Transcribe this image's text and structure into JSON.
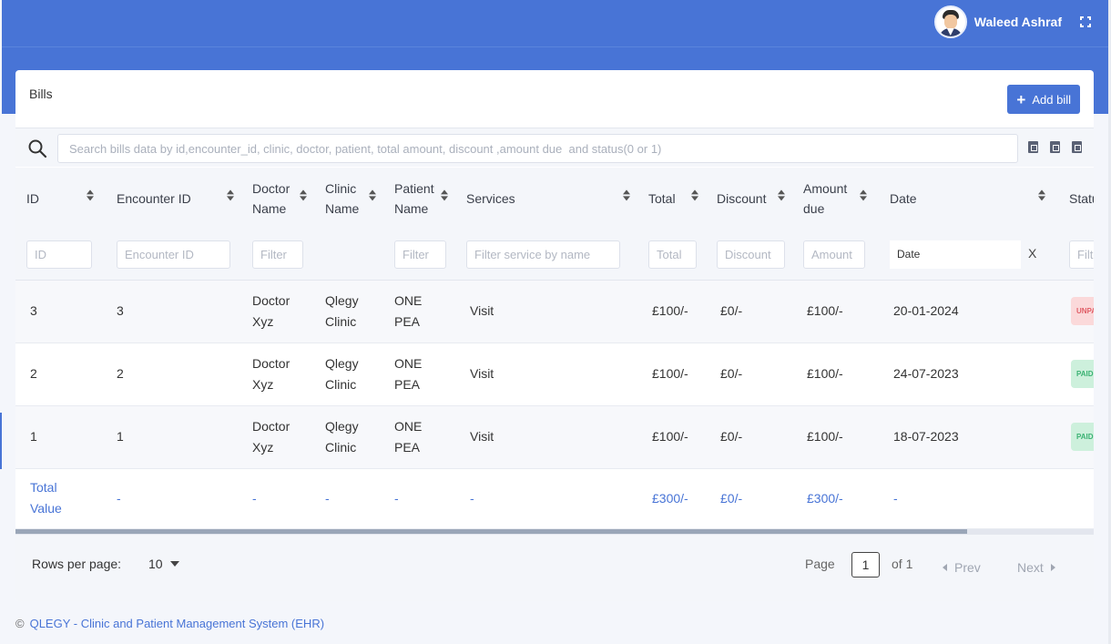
{
  "user": {
    "name": "Waleed Ashraf"
  },
  "page": {
    "title": "Bills",
    "add_button": "Add bill"
  },
  "search": {
    "placeholder": "Search bills data by id,encounter_id, clinic, doctor, patient, total amount, discount ,amount due  and status(0 or 1)"
  },
  "table": {
    "headers": {
      "id": "ID",
      "encounter": "Encounter ID",
      "doctor": "Doctor Name",
      "clinic": "Clinic Name",
      "patient": "Patient Name",
      "services": "Services",
      "total": "Total",
      "discount": "Discount",
      "due": "Amount due",
      "date": "Date",
      "status": "Status"
    },
    "filters": {
      "id": "ID",
      "encounter": "Encounter ID",
      "doctor": "Filter",
      "patient": "Filter",
      "services": "Filter service by name",
      "total": "Total",
      "discount": "Discount",
      "due": "Amount",
      "date": "Date",
      "date_clear": "X",
      "status": "Filter"
    },
    "rows": [
      {
        "id": "3",
        "encounter": "3",
        "doctor": "Doctor Xyz",
        "clinic": "Qlegy Clinic",
        "patient": "ONE PEA",
        "services": "Visit",
        "total": "£100/-",
        "discount": "£0/-",
        "due": "£100/-",
        "date": "20-01-2024",
        "status": "UNPAID"
      },
      {
        "id": "2",
        "encounter": "2",
        "doctor": "Doctor Xyz",
        "clinic": "Qlegy Clinic",
        "patient": "ONE PEA",
        "services": "Visit",
        "total": "£100/-",
        "discount": "£0/-",
        "due": "£100/-",
        "date": "24-07-2023",
        "status": "PAID"
      },
      {
        "id": "1",
        "encounter": "1",
        "doctor": "Doctor Xyz",
        "clinic": "Qlegy Clinic",
        "patient": "ONE PEA",
        "services": "Visit",
        "total": "£100/-",
        "discount": "£0/-",
        "due": "£100/-",
        "date": "18-07-2023",
        "status": "PAID"
      }
    ],
    "totals": {
      "label": "Total Value",
      "encounter": "-",
      "doctor": "-",
      "clinic": "-",
      "patient": "-",
      "services": "-",
      "total": "£300/-",
      "discount": "£0/-",
      "due": "£300/-",
      "date": "-"
    }
  },
  "pagination": {
    "rows_per_page_label": "Rows per page:",
    "rows_per_page": "10",
    "page_label": "Page",
    "page": "1",
    "of_label": "of 1",
    "prev": "Prev",
    "next": "Next"
  },
  "footer": {
    "symbol": "©",
    "text": "QLEGY - Clinic and Patient Management System (EHR)"
  },
  "colors": {
    "primary": "#4874d6",
    "unpaid_bg": "#fbd9da",
    "paid_bg": "#cdf0dc"
  }
}
